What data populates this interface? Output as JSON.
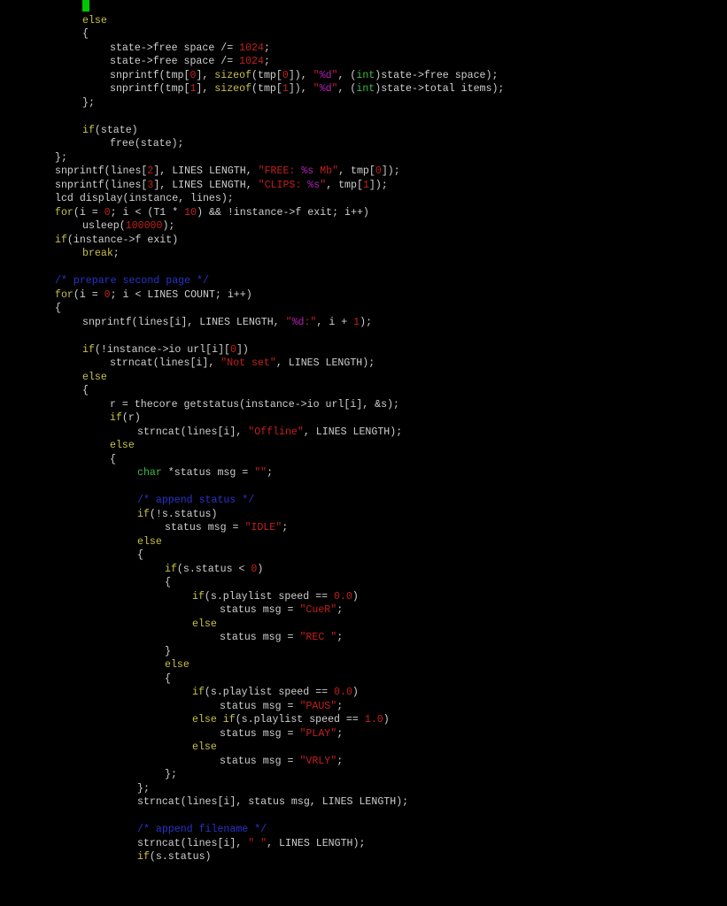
{
  "colors": {
    "background": "#000000",
    "text": "#cfcfcf",
    "keyword": "#c9c04a",
    "type": "#3fb84a",
    "string": "#c41f1f",
    "format": "#b021b4",
    "number": "#c41f1f",
    "comment": "#2a33c8",
    "cursor": "#00c800"
  },
  "editor": {
    "lines": [
      {
        "indent": 3,
        "tokens": []
      },
      {
        "indent": 3,
        "tokens": [
          {
            "t": "else",
            "c": "kw"
          }
        ]
      },
      {
        "indent": 3,
        "tokens": [
          {
            "t": "{",
            "c": "text"
          }
        ]
      },
      {
        "indent": 4,
        "tokens": [
          {
            "t": "state->free space /= ",
            "c": "text"
          },
          {
            "t": "1024",
            "c": "num"
          },
          {
            "t": ";",
            "c": "text"
          }
        ]
      },
      {
        "indent": 4,
        "tokens": [
          {
            "t": "state->free space /= ",
            "c": "text"
          },
          {
            "t": "1024",
            "c": "num"
          },
          {
            "t": ";",
            "c": "text"
          }
        ]
      },
      {
        "indent": 4,
        "tokens": [
          {
            "t": "snprintf(tmp[",
            "c": "text"
          },
          {
            "t": "0",
            "c": "num"
          },
          {
            "t": "], ",
            "c": "text"
          },
          {
            "t": "sizeof",
            "c": "kw"
          },
          {
            "t": "(tmp[",
            "c": "text"
          },
          {
            "t": "0",
            "c": "num"
          },
          {
            "t": "]), ",
            "c": "text"
          },
          {
            "t": "\"",
            "c": "str"
          },
          {
            "t": "%d",
            "c": "fmt"
          },
          {
            "t": "\"",
            "c": "str"
          },
          {
            "t": ", (",
            "c": "text"
          },
          {
            "t": "int",
            "c": "type"
          },
          {
            "t": ")state->free space);",
            "c": "text"
          }
        ]
      },
      {
        "indent": 4,
        "tokens": [
          {
            "t": "snprintf(tmp[",
            "c": "text"
          },
          {
            "t": "1",
            "c": "num"
          },
          {
            "t": "], ",
            "c": "text"
          },
          {
            "t": "sizeof",
            "c": "kw"
          },
          {
            "t": "(tmp[",
            "c": "text"
          },
          {
            "t": "1",
            "c": "num"
          },
          {
            "t": "]), ",
            "c": "text"
          },
          {
            "t": "\"",
            "c": "str"
          },
          {
            "t": "%d",
            "c": "fmt"
          },
          {
            "t": "\"",
            "c": "str"
          },
          {
            "t": ", (",
            "c": "text"
          },
          {
            "t": "int",
            "c": "type"
          },
          {
            "t": ")state->total items);",
            "c": "text"
          }
        ]
      },
      {
        "indent": 3,
        "tokens": [
          {
            "t": "};",
            "c": "text"
          }
        ]
      },
      {
        "indent": 0,
        "tokens": []
      },
      {
        "indent": 3,
        "tokens": [
          {
            "t": "if",
            "c": "kw"
          },
          {
            "t": "(state)",
            "c": "text"
          }
        ]
      },
      {
        "indent": 4,
        "tokens": [
          {
            "t": "free(state);",
            "c": "text"
          }
        ]
      },
      {
        "indent": 2,
        "tokens": [
          {
            "t": "};",
            "c": "text"
          }
        ]
      },
      {
        "indent": 2,
        "tokens": [
          {
            "t": "snprintf(lines[",
            "c": "text"
          },
          {
            "t": "2",
            "c": "num"
          },
          {
            "t": "], LINES LENGTH, ",
            "c": "text"
          },
          {
            "t": "\"FREE: ",
            "c": "str"
          },
          {
            "t": "%s",
            "c": "fmt"
          },
          {
            "t": " Mb\"",
            "c": "str"
          },
          {
            "t": ", tmp[",
            "c": "text"
          },
          {
            "t": "0",
            "c": "num"
          },
          {
            "t": "]);",
            "c": "text"
          }
        ]
      },
      {
        "indent": 2,
        "tokens": [
          {
            "t": "snprintf(lines[",
            "c": "text"
          },
          {
            "t": "3",
            "c": "num"
          },
          {
            "t": "], LINES LENGTH, ",
            "c": "text"
          },
          {
            "t": "\"CLIPS: ",
            "c": "str"
          },
          {
            "t": "%s",
            "c": "fmt"
          },
          {
            "t": "\"",
            "c": "str"
          },
          {
            "t": ", tmp[",
            "c": "text"
          },
          {
            "t": "1",
            "c": "num"
          },
          {
            "t": "]);",
            "c": "text"
          }
        ]
      },
      {
        "indent": 2,
        "tokens": [
          {
            "t": "lcd display(instance, lines);",
            "c": "text"
          }
        ]
      },
      {
        "indent": 2,
        "tokens": [
          {
            "t": "for",
            "c": "kw"
          },
          {
            "t": "(i = ",
            "c": "text"
          },
          {
            "t": "0",
            "c": "num"
          },
          {
            "t": "; i < (T1 * ",
            "c": "text"
          },
          {
            "t": "10",
            "c": "num"
          },
          {
            "t": ") && !instance->f exit; i++)",
            "c": "text"
          }
        ]
      },
      {
        "indent": 3,
        "tokens": [
          {
            "t": "usleep(",
            "c": "text"
          },
          {
            "t": "100000",
            "c": "num"
          },
          {
            "t": ");",
            "c": "text"
          }
        ]
      },
      {
        "indent": 2,
        "tokens": [
          {
            "t": "if",
            "c": "kw"
          },
          {
            "t": "(instance->f exit)",
            "c": "text"
          }
        ]
      },
      {
        "indent": 3,
        "tokens": [
          {
            "t": "break",
            "c": "kw"
          },
          {
            "t": ";",
            "c": "text"
          }
        ]
      },
      {
        "indent": 0,
        "tokens": []
      },
      {
        "indent": 2,
        "tokens": [
          {
            "t": "/* prepare second page */",
            "c": "cmt"
          }
        ]
      },
      {
        "indent": 2,
        "tokens": [
          {
            "t": "for",
            "c": "kw"
          },
          {
            "t": "(i = ",
            "c": "text"
          },
          {
            "t": "0",
            "c": "num"
          },
          {
            "t": "; i < LINES COUNT; i++)",
            "c": "text"
          }
        ]
      },
      {
        "indent": 2,
        "tokens": [
          {
            "t": "{",
            "c": "text"
          }
        ]
      },
      {
        "indent": 3,
        "tokens": [
          {
            "t": "snprintf(lines[i], LINES LENGTH, ",
            "c": "text"
          },
          {
            "t": "\"",
            "c": "str"
          },
          {
            "t": "%d",
            "c": "fmt"
          },
          {
            "t": ":\"",
            "c": "str"
          },
          {
            "t": ", i + ",
            "c": "text"
          },
          {
            "t": "1",
            "c": "num"
          },
          {
            "t": ");",
            "c": "text"
          }
        ]
      },
      {
        "indent": 0,
        "tokens": []
      },
      {
        "indent": 3,
        "tokens": [
          {
            "t": "if",
            "c": "kw"
          },
          {
            "t": "(!instance->io url[i][",
            "c": "text"
          },
          {
            "t": "0",
            "c": "num"
          },
          {
            "t": "])",
            "c": "text"
          }
        ]
      },
      {
        "indent": 4,
        "tokens": [
          {
            "t": "strncat(lines[i], ",
            "c": "text"
          },
          {
            "t": "\"Not set\"",
            "c": "str"
          },
          {
            "t": ", LINES LENGTH);",
            "c": "text"
          }
        ]
      },
      {
        "indent": 3,
        "tokens": [
          {
            "t": "else",
            "c": "kw"
          }
        ]
      },
      {
        "indent": 3,
        "tokens": [
          {
            "t": "{",
            "c": "text"
          }
        ]
      },
      {
        "indent": 4,
        "tokens": [
          {
            "t": "r = thecore getstatus(instance->io url[i], &s);",
            "c": "text"
          }
        ]
      },
      {
        "indent": 4,
        "tokens": [
          {
            "t": "if",
            "c": "kw"
          },
          {
            "t": "(r)",
            "c": "text"
          }
        ]
      },
      {
        "indent": 5,
        "tokens": [
          {
            "t": "strncat(lines[i], ",
            "c": "text"
          },
          {
            "t": "\"Offline\"",
            "c": "str"
          },
          {
            "t": ", LINES LENGTH);",
            "c": "text"
          }
        ]
      },
      {
        "indent": 4,
        "tokens": [
          {
            "t": "else",
            "c": "kw"
          }
        ]
      },
      {
        "indent": 4,
        "tokens": [
          {
            "t": "{",
            "c": "text"
          }
        ]
      },
      {
        "indent": 5,
        "tokens": [
          {
            "t": "char",
            "c": "type"
          },
          {
            "t": " *status msg = ",
            "c": "text"
          },
          {
            "t": "\"\"",
            "c": "str"
          },
          {
            "t": ";",
            "c": "text"
          }
        ]
      },
      {
        "indent": 0,
        "tokens": []
      },
      {
        "indent": 5,
        "tokens": [
          {
            "t": "/* append status */",
            "c": "cmt"
          }
        ]
      },
      {
        "indent": 5,
        "tokens": [
          {
            "t": "if",
            "c": "kw"
          },
          {
            "t": "(!s.status)",
            "c": "text"
          }
        ]
      },
      {
        "indent": 6,
        "tokens": [
          {
            "t": "status msg = ",
            "c": "text"
          },
          {
            "t": "\"IDLE\"",
            "c": "str"
          },
          {
            "t": ";",
            "c": "text"
          }
        ]
      },
      {
        "indent": 5,
        "tokens": [
          {
            "t": "else",
            "c": "kw"
          }
        ]
      },
      {
        "indent": 5,
        "tokens": [
          {
            "t": "{",
            "c": "text"
          }
        ]
      },
      {
        "indent": 6,
        "tokens": [
          {
            "t": "if",
            "c": "kw"
          },
          {
            "t": "(s.status < ",
            "c": "text"
          },
          {
            "t": "0",
            "c": "num"
          },
          {
            "t": ")",
            "c": "text"
          }
        ]
      },
      {
        "indent": 6,
        "tokens": [
          {
            "t": "{",
            "c": "text"
          }
        ]
      },
      {
        "indent": 7,
        "tokens": [
          {
            "t": "if",
            "c": "kw"
          },
          {
            "t": "(s.playlist speed == ",
            "c": "text"
          },
          {
            "t": "0.0",
            "c": "num"
          },
          {
            "t": ")",
            "c": "text"
          }
        ]
      },
      {
        "indent": 8,
        "tokens": [
          {
            "t": "status msg = ",
            "c": "text"
          },
          {
            "t": "\"CueR\"",
            "c": "str"
          },
          {
            "t": ";",
            "c": "text"
          }
        ]
      },
      {
        "indent": 7,
        "tokens": [
          {
            "t": "else",
            "c": "kw"
          }
        ]
      },
      {
        "indent": 8,
        "tokens": [
          {
            "t": "status msg = ",
            "c": "text"
          },
          {
            "t": "\"REC \"",
            "c": "str"
          },
          {
            "t": ";",
            "c": "text"
          }
        ]
      },
      {
        "indent": 6,
        "tokens": [
          {
            "t": "}",
            "c": "text"
          }
        ]
      },
      {
        "indent": 6,
        "tokens": [
          {
            "t": "else",
            "c": "kw"
          }
        ]
      },
      {
        "indent": 6,
        "tokens": [
          {
            "t": "{",
            "c": "text"
          }
        ]
      },
      {
        "indent": 7,
        "tokens": [
          {
            "t": "if",
            "c": "kw"
          },
          {
            "t": "(s.playlist speed == ",
            "c": "text"
          },
          {
            "t": "0.0",
            "c": "num"
          },
          {
            "t": ")",
            "c": "text"
          }
        ]
      },
      {
        "indent": 8,
        "tokens": [
          {
            "t": "status msg = ",
            "c": "text"
          },
          {
            "t": "\"PAUS\"",
            "c": "str"
          },
          {
            "t": ";",
            "c": "text"
          }
        ]
      },
      {
        "indent": 7,
        "tokens": [
          {
            "t": "else if",
            "c": "kw"
          },
          {
            "t": "(s.playlist speed == ",
            "c": "text"
          },
          {
            "t": "1.0",
            "c": "num"
          },
          {
            "t": ")",
            "c": "text"
          }
        ]
      },
      {
        "indent": 8,
        "tokens": [
          {
            "t": "status msg = ",
            "c": "text"
          },
          {
            "t": "\"PLAY\"",
            "c": "str"
          },
          {
            "t": ";",
            "c": "text"
          }
        ]
      },
      {
        "indent": 7,
        "tokens": [
          {
            "t": "else",
            "c": "kw"
          }
        ]
      },
      {
        "indent": 8,
        "tokens": [
          {
            "t": "status msg = ",
            "c": "text"
          },
          {
            "t": "\"VRLY\"",
            "c": "str"
          },
          {
            "t": ";",
            "c": "text"
          }
        ]
      },
      {
        "indent": 6,
        "tokens": [
          {
            "t": "};",
            "c": "text"
          }
        ]
      },
      {
        "indent": 5,
        "tokens": [
          {
            "t": "};",
            "c": "text"
          }
        ]
      },
      {
        "indent": 5,
        "tokens": [
          {
            "t": "strncat(lines[i], status msg, LINES LENGTH);",
            "c": "text"
          }
        ]
      },
      {
        "indent": 0,
        "tokens": []
      },
      {
        "indent": 5,
        "tokens": [
          {
            "t": "/* append filename */",
            "c": "cmt"
          }
        ]
      },
      {
        "indent": 5,
        "tokens": [
          {
            "t": "strncat(lines[i], ",
            "c": "text"
          },
          {
            "t": "\" \"",
            "c": "str"
          },
          {
            "t": ", LINES LENGTH);",
            "c": "text"
          }
        ]
      },
      {
        "indent": 5,
        "tokens": [
          {
            "t": "if",
            "c": "kw"
          },
          {
            "t": "(s.status)",
            "c": "text"
          }
        ]
      }
    ]
  }
}
